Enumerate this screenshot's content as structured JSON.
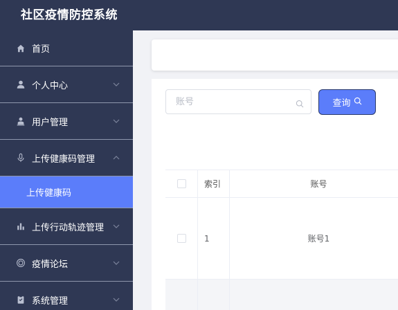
{
  "app": {
    "title": "社区疫情防控系统"
  },
  "sidebar": {
    "items": [
      {
        "label": "首页",
        "icon": "home-icon",
        "chevron": false
      },
      {
        "label": "个人中心",
        "icon": "user-icon",
        "chevron": "down"
      },
      {
        "label": "用户管理",
        "icon": "user-manage-icon",
        "chevron": "down"
      },
      {
        "label": "上传健康码管理",
        "icon": "microphone-icon",
        "chevron": "up",
        "expanded": true,
        "children": [
          {
            "label": "上传健康码",
            "active": true
          }
        ]
      },
      {
        "label": "上传行动轨迹管理",
        "icon": "bar-chart-icon",
        "chevron": "down"
      },
      {
        "label": "疫情论坛",
        "icon": "forum-icon",
        "chevron": "down"
      },
      {
        "label": "系统管理",
        "icon": "clipboard-icon",
        "chevron": "down"
      }
    ]
  },
  "search": {
    "placeholder": "账号",
    "value": "",
    "button_label": "查询"
  },
  "table": {
    "columns": [
      "",
      "索引",
      "账号"
    ],
    "rows": [
      {
        "index": "1",
        "account": "账号1"
      },
      {
        "index": "",
        "account": ""
      }
    ]
  },
  "colors": {
    "sidebar_bg": "#2f3854",
    "accent": "#5b7dfa",
    "page_bg": "#f1f2f6"
  }
}
